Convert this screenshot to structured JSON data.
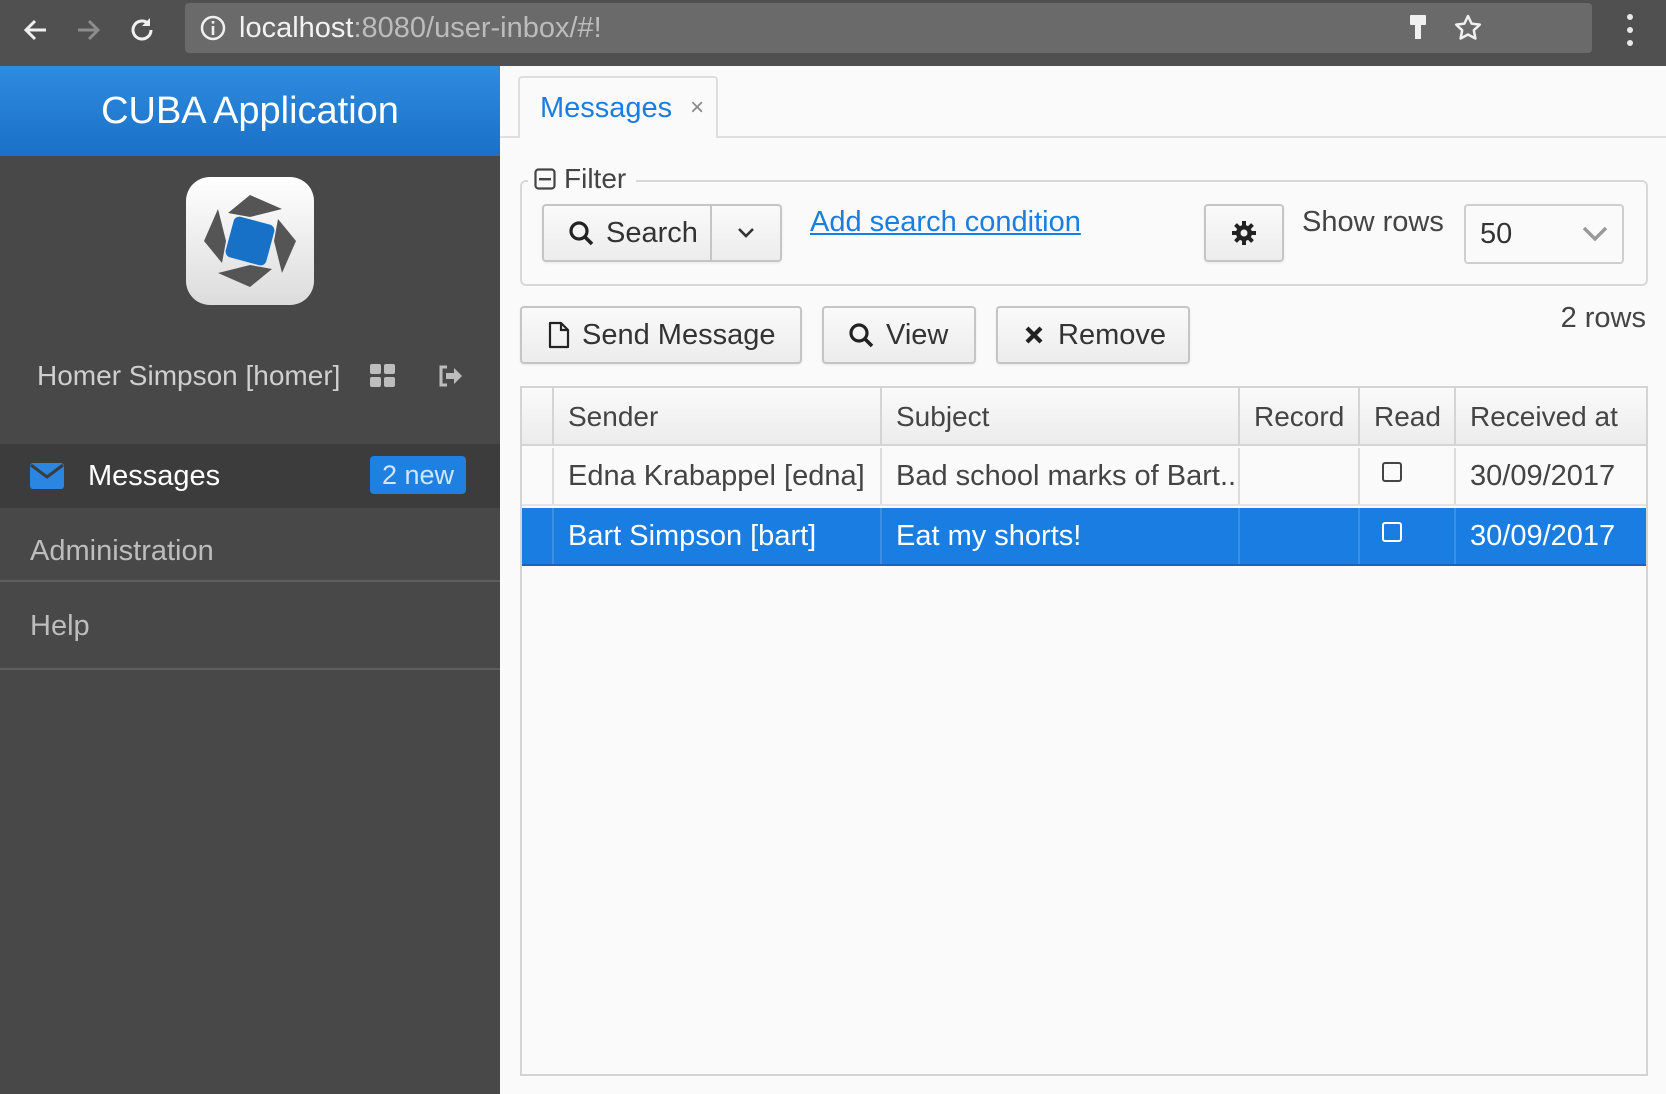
{
  "browser": {
    "url_host": "localhost",
    "url_rest": ":8080/user-inbox/#!"
  },
  "sidebar": {
    "app_title": "CUBA Application",
    "user_name": "Homer Simpson [homer]",
    "items": [
      {
        "label": "Messages",
        "badge": "2 new",
        "icon": "envelope-icon"
      },
      {
        "label": "Administration"
      },
      {
        "label": "Help"
      }
    ]
  },
  "tabs": [
    {
      "label": "Messages",
      "close": "×"
    }
  ],
  "filter": {
    "legend": "Filter",
    "search_label": "Search",
    "add_condition": "Add search condition",
    "show_rows_label": "Show rows",
    "show_rows_value": "50"
  },
  "toolbar": {
    "send_label": "Send Message",
    "view_label": "View",
    "remove_label": "Remove",
    "rows_count": "2 rows"
  },
  "table": {
    "columns": [
      "Sender",
      "Subject",
      "Record",
      "Read",
      "Received at"
    ],
    "rows": [
      {
        "sender": "Edna Krabappel [edna]",
        "subject": "Bad school marks of Bart...",
        "record": "",
        "read": false,
        "received": "30/09/2017"
      },
      {
        "sender": "Bart Simpson [bart]",
        "subject": "Eat my shorts!",
        "record": "",
        "read": false,
        "received": "30/09/2017",
        "selected": true
      }
    ]
  },
  "colors": {
    "accent": "#197de1",
    "sidebar_bg": "#484848",
    "header_blue": "#2f8cdf"
  }
}
